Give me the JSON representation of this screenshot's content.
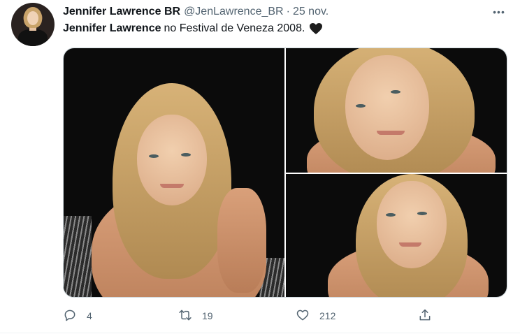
{
  "tweet": {
    "author_name": "Jennifer Lawrence BR",
    "handle": "@JenLawrence_BR",
    "separator": "·",
    "date": "25 nov.",
    "more_label": "•••",
    "text_bold": "Jennifer Lawrence",
    "text_rest": "no Festival de Veneza 2008.",
    "emoji": "black-heart-icon"
  },
  "media": {
    "photos": [
      {
        "name": "photo-left",
        "position": "left"
      },
      {
        "name": "photo-top-right",
        "position": "top-right"
      },
      {
        "name": "photo-bottom-right",
        "position": "bottom-right"
      }
    ]
  },
  "actions": {
    "reply_count": "4",
    "retweet_count": "19",
    "like_count": "212",
    "reply_icon": "reply-icon",
    "retweet_icon": "retweet-icon",
    "like_icon": "heart-icon",
    "share_icon": "share-icon"
  },
  "colors": {
    "text_primary": "#0f1419",
    "text_secondary": "#536471",
    "border": "#cfd9de"
  }
}
